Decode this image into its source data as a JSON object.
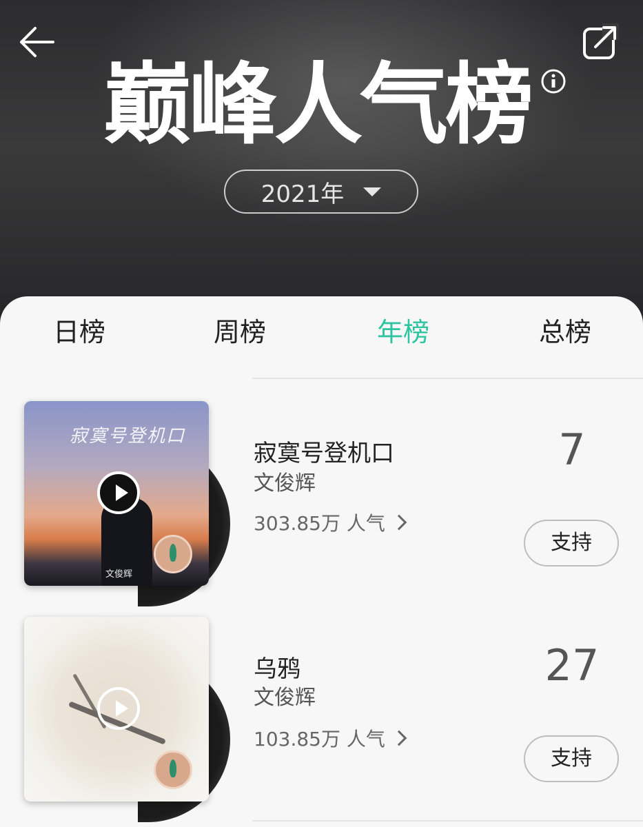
{
  "header": {
    "title": "巅峰人气榜",
    "year_select": {
      "value": "2021年"
    }
  },
  "tabs": [
    {
      "label": "日榜",
      "active": false
    },
    {
      "label": "周榜",
      "active": false
    },
    {
      "label": "年榜",
      "active": true
    },
    {
      "label": "总榜",
      "active": false
    }
  ],
  "songs": [
    {
      "title": "寂寞号登机口",
      "artist": "文俊辉",
      "popularity": "303.85万 人气",
      "rank": "7",
      "support_label": "支持",
      "cover_text": "寂寞号登机口",
      "cover_artist": "文俊辉"
    },
    {
      "title": "乌鸦",
      "artist": "文俊辉",
      "popularity": "103.85万 人气",
      "rank": "27",
      "support_label": "支持"
    }
  ],
  "icons": {
    "back": "arrow-left-icon",
    "share": "share-external-icon",
    "info": "info-icon",
    "play": "play-icon"
  },
  "colors": {
    "accent": "#2ec4a0",
    "header_bg": "#2e2e30",
    "panel_bg": "#f7f7f7"
  }
}
